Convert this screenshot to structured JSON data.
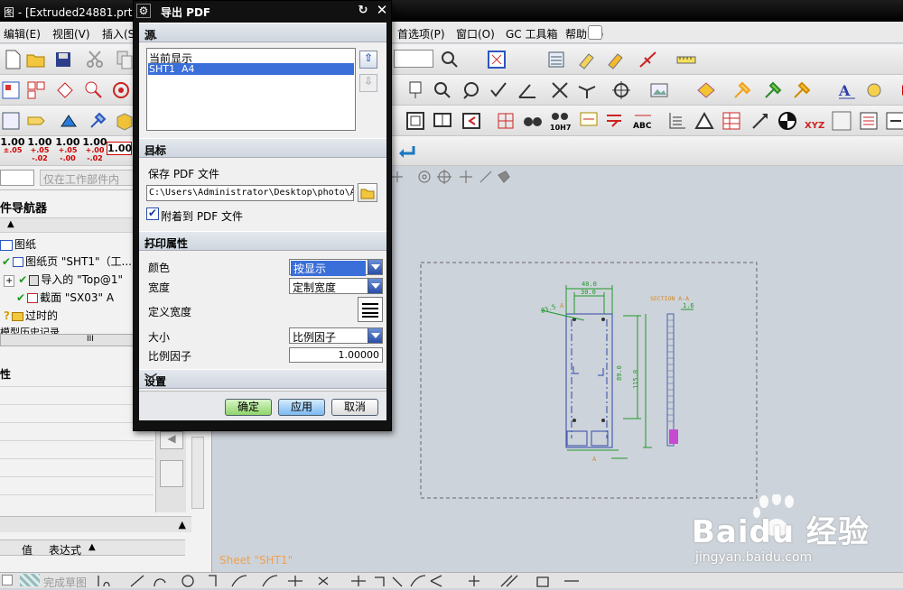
{
  "window": {
    "title": "图 - [Extruded24881.prt  ("
  },
  "menu": [
    "编辑(E)",
    "视图(V)",
    "插入(S",
    "首选项(P)",
    "窗口(O)",
    "GC 工具箱",
    "帮助(H)"
  ],
  "dim_icons": [
    {
      "main": "1.00",
      "a": "±.05",
      "b": ""
    },
    {
      "main": "1.00",
      "a": "+.05",
      "b": "-.02"
    },
    {
      "main": "1.00",
      "a": "+.05",
      "b": "-.00"
    },
    {
      "main": "1.00",
      "a": "+.00",
      "b": "-.02"
    },
    {
      "main": "1.00",
      "a": "",
      "b": ""
    }
  ],
  "filter_text": "仅在工作部件内",
  "navigator": {
    "title": "件导航器",
    "items": [
      "图纸",
      "图纸页 \"SHT1\"（工...",
      "导入的 \"Top@1\"",
      "截面 \"SX03\" A",
      "过时的",
      "模型历史记录"
    ],
    "details_title": "性",
    "columns": [
      "值",
      "表达式"
    ]
  },
  "dialog": {
    "title": "导出 PDF",
    "source": {
      "header": "源",
      "items": [
        "当前显示",
        "SHT1  A4"
      ],
      "selected": 1
    },
    "target": {
      "header": "目标",
      "save_label": "保存 PDF 文件",
      "path": "C:\\Users\\Administrator\\Desktop\\photo\\A",
      "attach_label": "附着到 PDF 文件",
      "attach_checked": true
    },
    "print": {
      "header": "打印属性",
      "color_label": "颜色",
      "color_value": "按显示",
      "width_label": "宽度",
      "width_value": "定制宽度",
      "define_width_label": "定义宽度",
      "size_label": "大小",
      "size_value": "比例因子",
      "scale_label": "比例因子",
      "scale_value": "1.00000"
    },
    "settings_header": "设置",
    "buttons": {
      "ok": "确定",
      "apply": "应用",
      "cancel": "取消"
    }
  },
  "drawing": {
    "dims": [
      "40.0",
      "30.0",
      "Ø3.5",
      "89.0",
      "115.0",
      "SECTION A-A",
      "1.6",
      "A",
      "A"
    ],
    "sheet_label": "Sheet \"SHT1\""
  },
  "bottom": {
    "finish_sketch": "完成草图"
  },
  "watermark": {
    "brand": "Baidu 经验",
    "url": "jingyan.baidu.com"
  },
  "colors": {
    "drawing_blue": "#4a5fb0",
    "drawing_green": "#1f9a2a",
    "sheet_label": "#f0a050"
  }
}
